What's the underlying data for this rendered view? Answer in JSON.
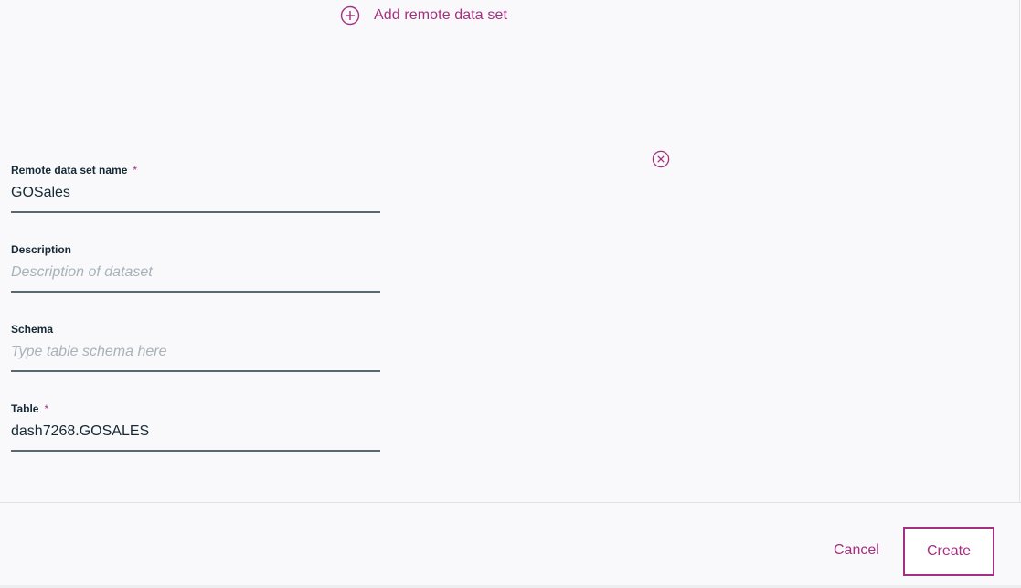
{
  "add_remote": {
    "label": "Add remote data set",
    "icon": "plus-circle-icon"
  },
  "remove_icon": "close-circle-icon",
  "form": {
    "name": {
      "label": "Remote data set name",
      "required_mark": "*",
      "value": "GOSales",
      "placeholder": ""
    },
    "description": {
      "label": "Description",
      "value": "",
      "placeholder": "Description of dataset"
    },
    "schema": {
      "label": "Schema",
      "value": "",
      "placeholder": "Type table schema here"
    },
    "table": {
      "label": "Table",
      "required_mark": "*",
      "value": "dash7268.GOSALES",
      "placeholder": ""
    }
  },
  "footer": {
    "cancel_label": "Cancel",
    "create_label": "Create"
  },
  "colors": {
    "accent": "#a5307f",
    "text": "#152935",
    "background": "#f9f9fb",
    "input_underline": "#5a6872",
    "placeholder": "#a8b2b9"
  }
}
